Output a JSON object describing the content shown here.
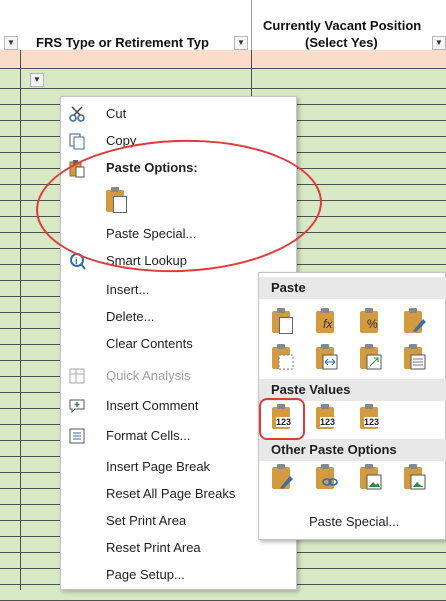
{
  "headers": {
    "col1": "FRS Type or Retirement Typ",
    "col2_line1": "Currently Vacant Position",
    "col2_line2": "(Select Yes)"
  },
  "colors": {
    "row_pink": "#fbdcc9",
    "row_green": "#d8e9c5",
    "annotation_red": "#e23a3a",
    "menu_bg": "#ffffff"
  },
  "context_menu": {
    "cut": "Cut",
    "copy": "Copy",
    "paste_options": "Paste Options:",
    "paste_special": "Paste Special...",
    "smart_lookup": "Smart Lookup",
    "insert": "Insert...",
    "delete": "Delete...",
    "clear_contents": "Clear Contents",
    "quick_analysis": "Quick Analysis",
    "insert_comment": "Insert Comment",
    "format_cells": "Format Cells...",
    "insert_page_break": "Insert Page Break",
    "reset_all_page_breaks": "Reset All Page Breaks",
    "set_print_area": "Set Print Area",
    "reset_print_area": "Reset Print Area",
    "page_setup": "Page Setup..."
  },
  "paste_submenu": {
    "paste": "Paste",
    "paste_values": "Paste Values",
    "other_paste_options": "Other Paste Options",
    "paste_special": "Paste Special...",
    "badge_123": "123",
    "glyph_fx": "fx",
    "glyph_pct": "%"
  }
}
